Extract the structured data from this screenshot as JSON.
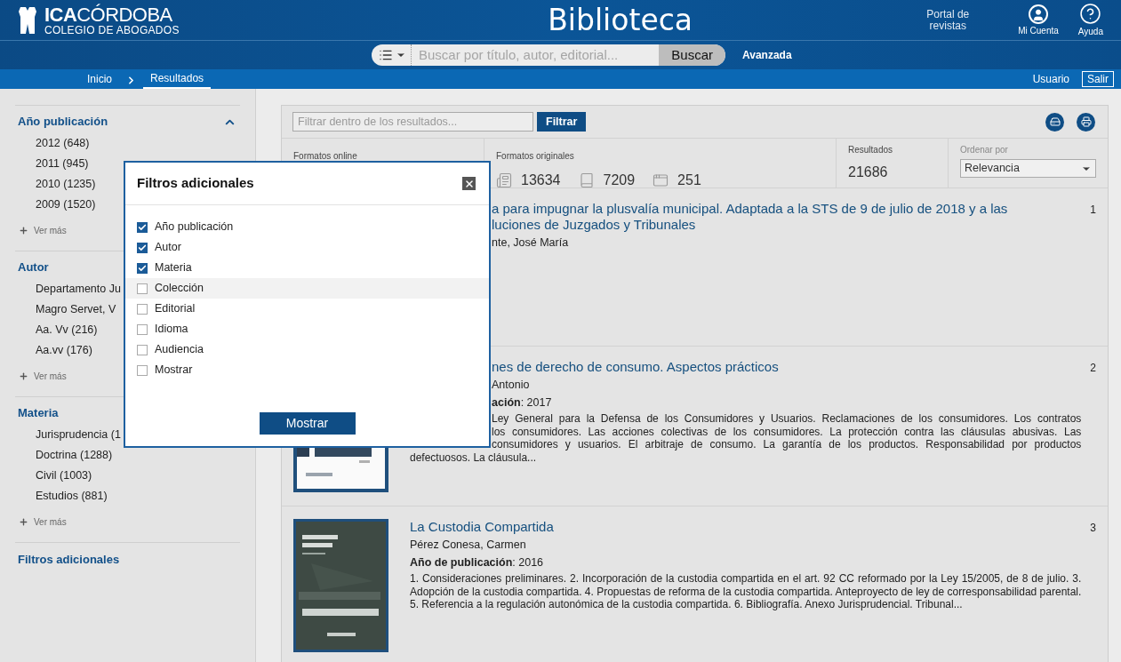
{
  "header": {
    "logo_mark": "ICA",
    "logo_city": "CÓRDOBA",
    "logo_subtitle": "COLEGIO DE ABOGADOS",
    "title": "Biblioteca",
    "portal_link": "Portal de revistas",
    "actions": [
      {
        "kind": "account",
        "label": "Mi Cuenta"
      },
      {
        "kind": "help",
        "label": "Ayuda"
      }
    ]
  },
  "search": {
    "placeholder": "Buscar por título, autor, editorial...",
    "button": "Buscar",
    "advanced": "Avanzada"
  },
  "breadcrumb": [
    {
      "label": "Inicio",
      "selected": false
    },
    {
      "label": "Resultados",
      "selected": true
    }
  ],
  "user": {
    "name": "Usuario",
    "logout": "Salir"
  },
  "sidebar": {
    "facets": [
      {
        "title": "Año publicación",
        "expanded": true,
        "items": [
          "2012 (648)",
          "2011 (945)",
          "2010 (1235)",
          "2009 (1520)"
        ],
        "more": "Ver más"
      },
      {
        "title": "Autor",
        "items": [
          "Departamento Ju",
          "Magro Servet, V",
          "Aa. Vv (216)",
          "Aa.vv (176)"
        ],
        "more": "Ver más"
      },
      {
        "title": "Materia",
        "items": [
          "Jurisprudencia (1",
          "Doctrina (1288)",
          "Civil (1003)",
          "Estudios (881)"
        ],
        "more": "Ver más"
      }
    ],
    "extra_filters": "Filtros adicionales"
  },
  "results": {
    "filter_placeholder": "Filtrar dentro de los resultados...",
    "filter_button": "Filtrar",
    "stats": {
      "online_label": "Formatos online",
      "original_label": "Formatos originales",
      "formats": [
        {
          "kind": "document",
          "count": "13634"
        },
        {
          "kind": "book",
          "count": "7209"
        },
        {
          "kind": "window",
          "count": "251"
        }
      ],
      "results_label": "Resultados",
      "results_count": "21686",
      "sort_label": "Ordenar por",
      "sort_value": "Relevancia"
    },
    "items": [
      {
        "number": "1",
        "title_lines": [
          "a para impugnar la plusvalía municipal. Adaptada a la STS de 9 de julio de 2018 y a las",
          "luciones de Juzgados y Tribunales"
        ],
        "author": "nte, José María"
      },
      {
        "number": "2",
        "cover": {
          "kind": "picture"
        },
        "title_lines": [
          "nes de derecho de consumo. Aspectos prácticos"
        ],
        "author": "Antonio",
        "year_line": "**ación**: 2017",
        "description_lines": [
          "Ley General para la Defensa de los Consumidores y Usuarios. Reclamaciones de los consumidores. Los contratos",
          "los consumidores. Las acciones colectivas de los consumidores. La protección contra las cláusulas abusivas. Las",
          "consumidores y usuarios. El arbitraje de consumo. La garantía de los productos. Responsabilidad por productos"
        ],
        "description_tail": "defectuosos. La cláusula..."
      },
      {
        "number": "3",
        "cover": {
          "kind": "picture"
        },
        "title_lines": [
          "La Custodia Compartida"
        ],
        "author": "Pérez Conesa, Carmen",
        "year_line": "**Año de publicación**: 2016",
        "description_tail": "1. Consideraciones preliminares. 2. Incorporación de la custodia compartida en el art. 92 CC reformado por la Ley 15/2005, de 8 de julio. 3. Adopción de la custodia compartida. 4. Propuestas de reforma de la custodia compartida. Anteproyecto de ley de corresponsabilidad parental. 5. Referencia a la regulación autonómica de la custodia compartida. 6. Bibliografía. Anexo Jurisprudencial. Tribunal..."
      }
    ]
  },
  "modal": {
    "title": "Filtros adicionales",
    "options": [
      {
        "label": "Año publicación",
        "checked": true,
        "highlighted": false
      },
      {
        "label": "Autor",
        "checked": true,
        "highlighted": false
      },
      {
        "label": "Materia",
        "checked": true,
        "highlighted": false
      },
      {
        "label": "Colección",
        "checked": false,
        "highlighted": true
      },
      {
        "label": "Editorial",
        "checked": false,
        "highlighted": false
      },
      {
        "label": "Idioma",
        "checked": false,
        "highlighted": false
      },
      {
        "label": "Audiencia",
        "checked": false,
        "highlighted": false
      },
      {
        "label": "Mostrar",
        "checked": false,
        "highlighted": false
      }
    ],
    "button": "Mostrar"
  }
}
